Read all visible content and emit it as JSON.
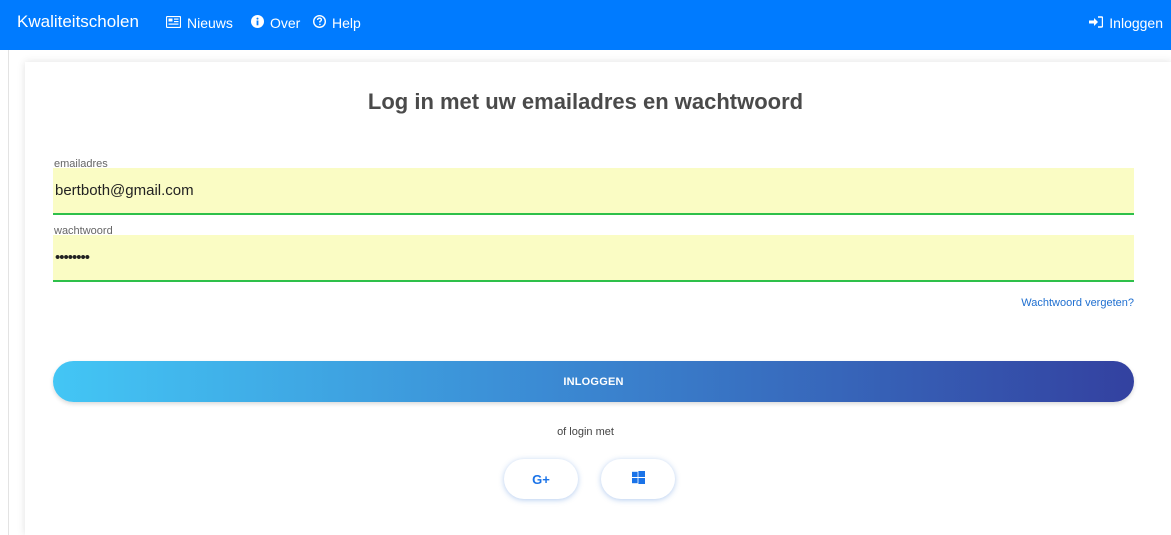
{
  "nav": {
    "brand": "Kwaliteitscholen",
    "items": [
      {
        "label": "Nieuws",
        "icon": "newspaper-icon"
      },
      {
        "label": "Over",
        "icon": "info-icon"
      },
      {
        "label": "Help",
        "icon": "question-icon"
      }
    ],
    "login": {
      "label": "Inloggen",
      "icon": "sign-in-icon"
    },
    "color": "#007bff"
  },
  "form": {
    "title": "Log in met uw emailadres en wachtwoord",
    "email": {
      "label": "emailadres",
      "value": "bertboth@gmail.com"
    },
    "password": {
      "label": "wachtwoord",
      "value": "••••••••"
    },
    "forgot_link": "Wachtwoord vergeten?",
    "submit_label": "INLOGGEN",
    "alt_login_text": "of login met",
    "social": [
      {
        "label": "G+",
        "icon": "google-plus-icon"
      },
      {
        "label": "",
        "icon": "windows-icon"
      }
    ]
  }
}
